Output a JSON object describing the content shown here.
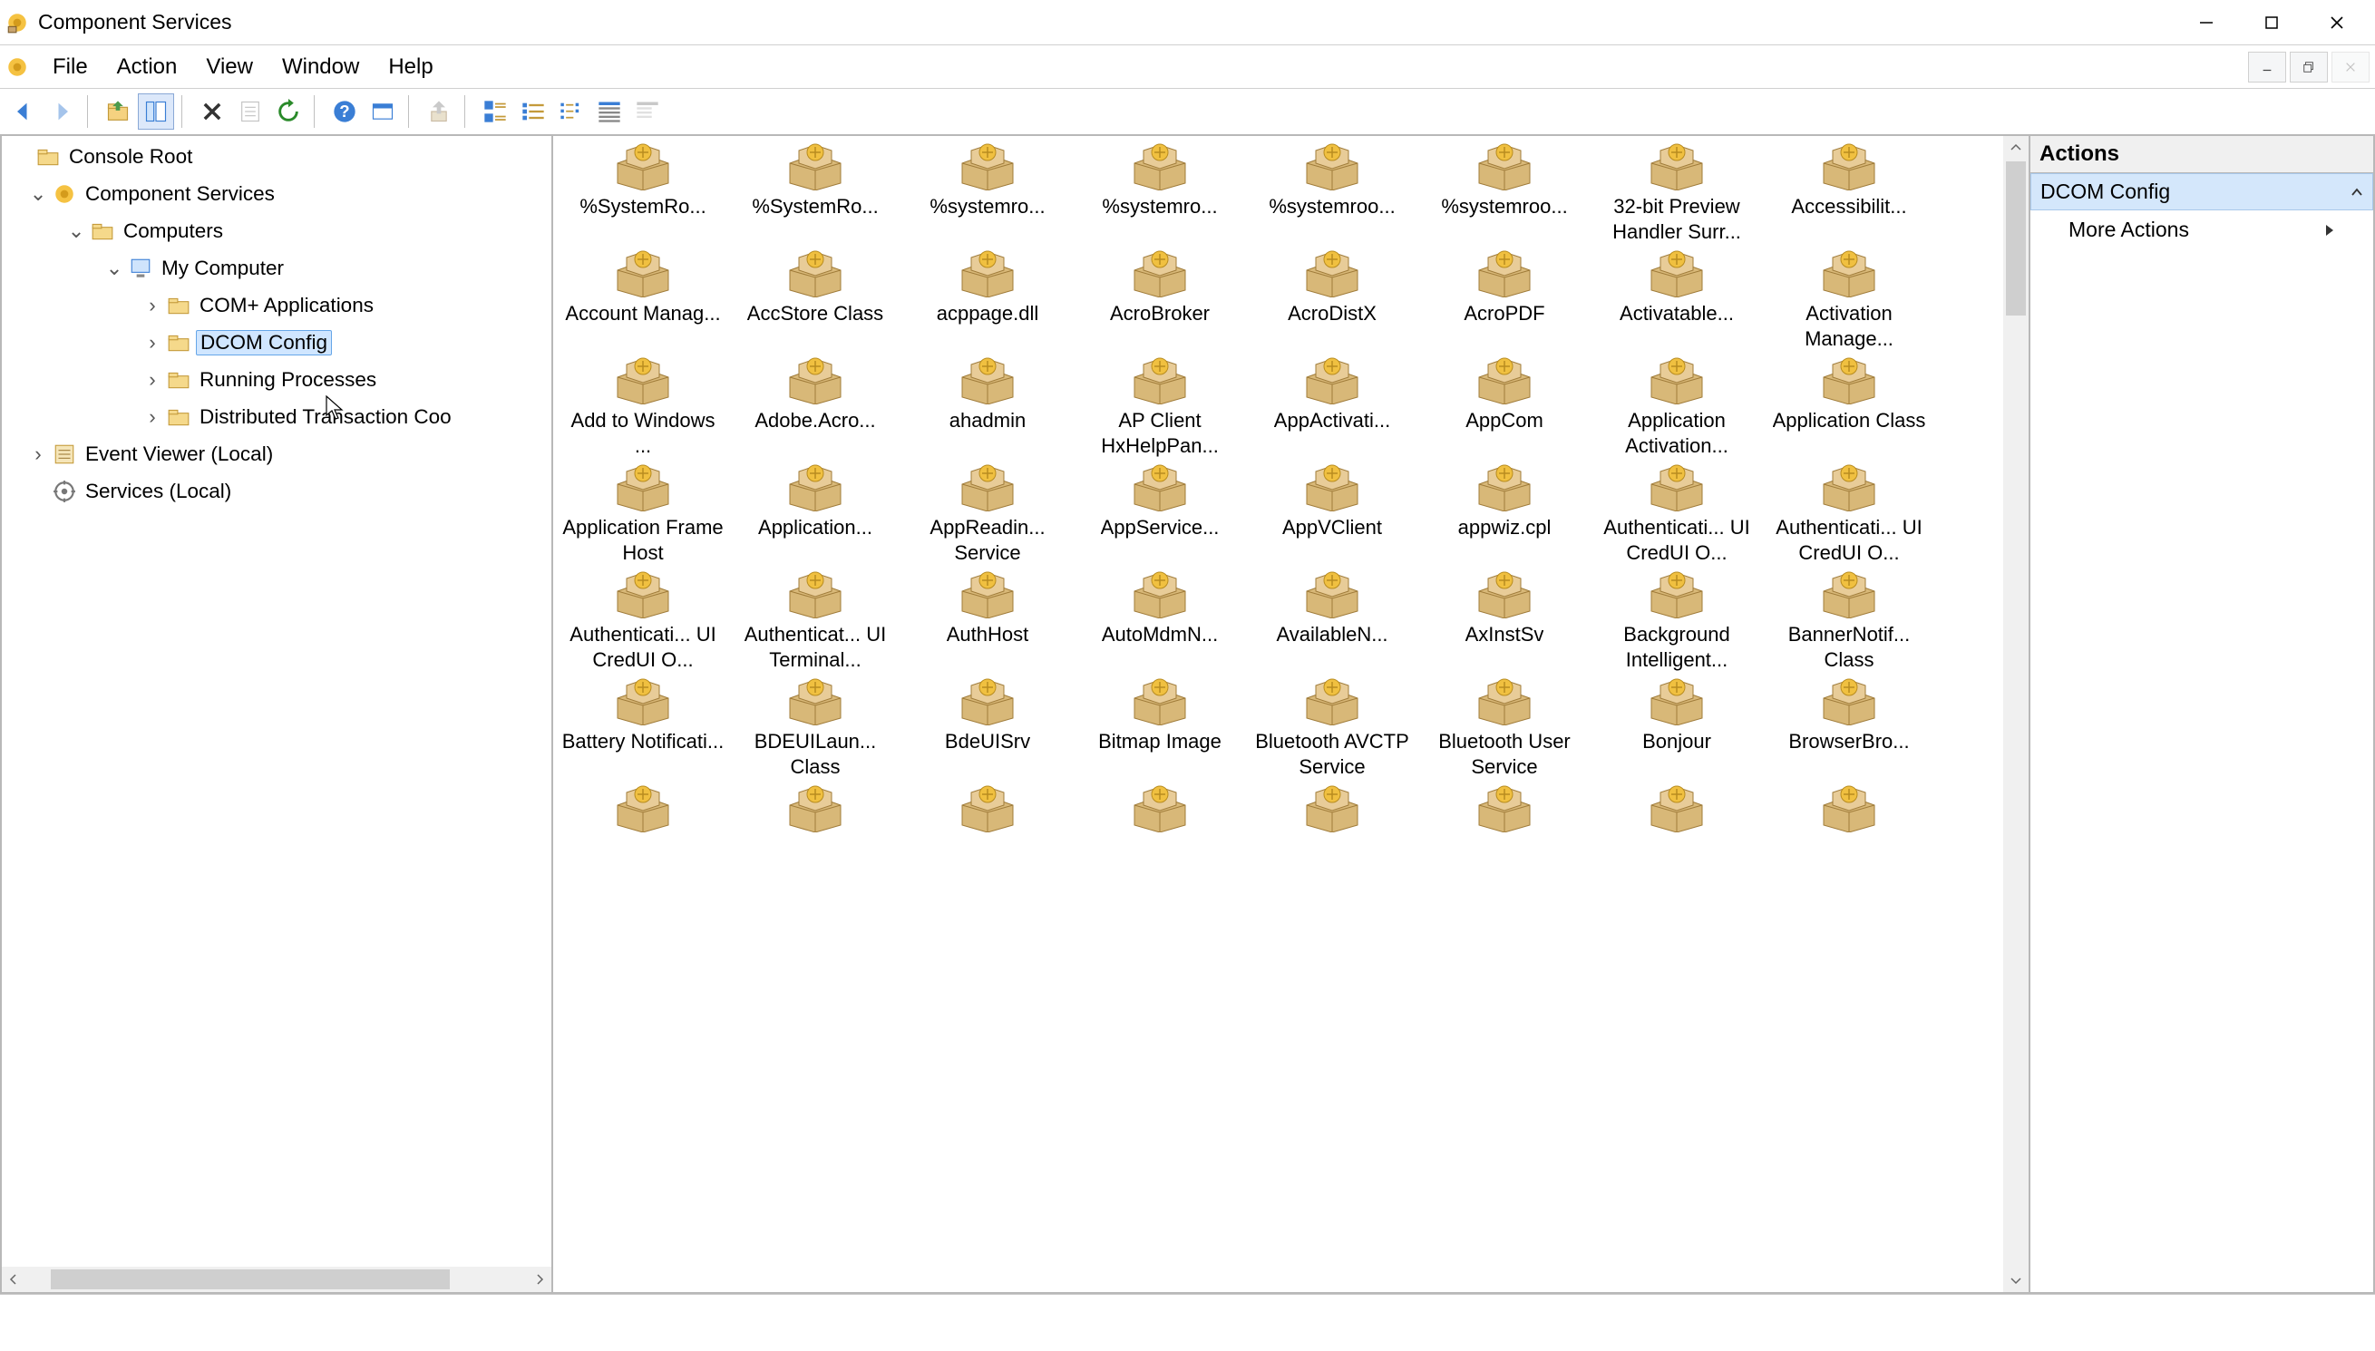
{
  "title": "Component Services",
  "menu": {
    "file": "File",
    "action": "Action",
    "view": "View",
    "window": "Window",
    "help": "Help"
  },
  "tree": {
    "console_root": "Console Root",
    "component_services": "Component Services",
    "computers": "Computers",
    "my_computer": "My Computer",
    "com_applications": "COM+ Applications",
    "dcom_config": "DCOM Config",
    "running_processes": "Running Processes",
    "dtc": "Distributed Transaction Coo",
    "event_viewer": "Event Viewer (Local)",
    "services": "Services (Local)"
  },
  "actions": {
    "header": "Actions",
    "selected": "DCOM Config",
    "more": "More Actions"
  },
  "items": [
    "%SystemRo...",
    "%SystemRo...",
    "%systemro...",
    "%systemro...",
    "%systemroo...",
    "%systemroo...",
    "32-bit Preview Handler Surr...",
    "Accessibilit...",
    "Account Manag...",
    "AccStore Class",
    "acppage.dll",
    "AcroBroker",
    "AcroDistX",
    "AcroPDF",
    "Activatable...",
    "Activation Manage...",
    "Add to Windows ...",
    "Adobe.Acro...",
    "ahadmin",
    "AP Client HxHelpPan...",
    "AppActivati...",
    "AppCom",
    "Application Activation...",
    "Application Class",
    "Application Frame Host",
    "Application...",
    "AppReadin... Service",
    "AppService...",
    "AppVClient",
    "appwiz.cpl",
    "Authenticati... UI CredUI O...",
    "Authenticati... UI CredUI O...",
    "Authenticati... UI CredUI O...",
    "Authenticat... UI Terminal...",
    "AuthHost",
    "AutoMdmN...",
    "AvailableN...",
    "AxInstSv",
    "Background Intelligent...",
    "BannerNotif... Class",
    "Battery Notificati...",
    "BDEUILaun... Class",
    "BdeUISrv",
    "Bitmap Image",
    "Bluetooth AVCTP Service",
    "Bluetooth User Service",
    "Bonjour",
    "BrowserBro...",
    "",
    "",
    "",
    "",
    "",
    "",
    "",
    ""
  ]
}
